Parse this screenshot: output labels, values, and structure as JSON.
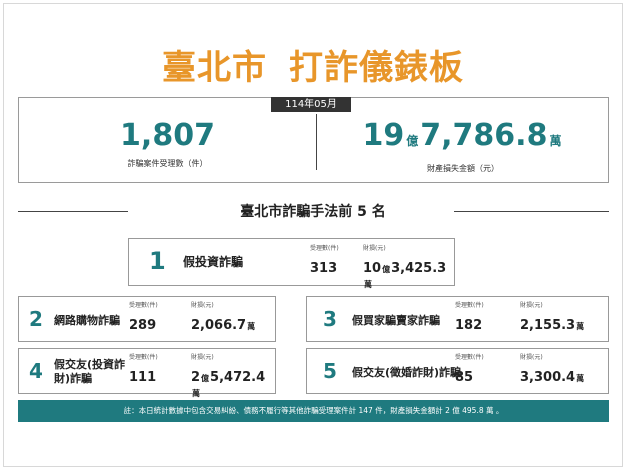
{
  "title_part1": "臺北市",
  "title_part2": "打詐儀錶板",
  "month": "114年05月",
  "summary": {
    "cases_value": "1,807",
    "cases_label": "詐騙案件受理數（件）",
    "loss_yi": "19",
    "loss_yi_unit": "億",
    "loss_wan": "7,786.8",
    "loss_wan_unit": "萬",
    "loss_label": "財產損失金額（元）"
  },
  "section_title": "臺北市詐騙手法前 5 名",
  "count_label": "受理數(件)",
  "loss_label": "財損(元)",
  "wan_unit": "萬",
  "yi_unit": "億",
  "top5": [
    {
      "rank": "1",
      "name": "假投資詐騙",
      "count": "313",
      "loss_yi": "10",
      "loss_wan": "3,425.3"
    },
    {
      "rank": "2",
      "name": "網路購物詐騙",
      "count": "289",
      "loss_yi": "",
      "loss_wan": "2,066.7"
    },
    {
      "rank": "3",
      "name": "假買家騙賣家詐騙",
      "count": "182",
      "loss_yi": "",
      "loss_wan": "2,155.3"
    },
    {
      "rank": "4",
      "name_line1": "假交友(投資詐",
      "name_line2": "財)詐騙",
      "count": "111",
      "loss_yi": "2",
      "loss_wan": "5,472.4"
    },
    {
      "rank": "5",
      "name": "假交友(徵婚詐財)詐騙",
      "count": "85",
      "loss_yi": "",
      "loss_wan": "3,300.4"
    }
  ],
  "footnote": "註：本日統計數據中包含交易糾紛、債務不履行等其他詐騙受理案件計 147 件，財產損失金額計 2 億 495.8 萬 。",
  "colors": {
    "accent": "#1f7a7f",
    "title": "#e8962a",
    "note_bg": "#1f7a7f"
  }
}
